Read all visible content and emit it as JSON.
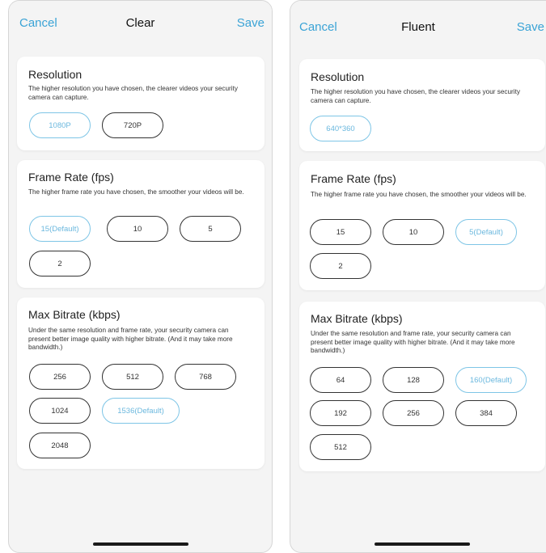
{
  "left": {
    "nav": {
      "cancel": "Cancel",
      "title": "Clear",
      "save": "Save"
    },
    "resolution": {
      "title": "Resolution",
      "desc": "The higher resolution you have chosen, the clearer videos your security camera can capture.",
      "options": [
        "1080P",
        "720P"
      ],
      "selected": "1080P"
    },
    "frame_rate": {
      "title": "Frame Rate (fps)",
      "desc": "The higher frame rate you have chosen, the smoother your videos will be.",
      "options": [
        "15(Default)",
        "10",
        "5",
        "2"
      ],
      "selected": "15(Default)"
    },
    "bitrate": {
      "title": "Max Bitrate (kbps)",
      "desc": "Under the same resolution and frame rate, your security camera can present better image quality with higher bitrate. (And it may take more bandwidth.)",
      "options": [
        "256",
        "512",
        "768",
        "1024",
        "1536(Default)",
        "2048"
      ],
      "selected": "1536(Default)"
    }
  },
  "right": {
    "nav": {
      "cancel": "Cancel",
      "title": "Fluent",
      "save": "Save"
    },
    "resolution": {
      "title": "Resolution",
      "desc": "The higher resolution you have chosen, the clearer videos your security camera can capture.",
      "options": [
        "640*360"
      ],
      "selected": "640*360"
    },
    "frame_rate": {
      "title": "Frame Rate (fps)",
      "desc": "The higher frame rate you have chosen, the smoother your videos will be.",
      "options": [
        "15",
        "10",
        "5(Default)",
        "2"
      ],
      "selected": "5(Default)"
    },
    "bitrate": {
      "title": "Max Bitrate (kbps)",
      "desc": "Under the same resolution and frame rate, your security camera can present better image quality with higher bitrate. (And it may take more bandwidth.)",
      "options": [
        "64",
        "128",
        "160(Default)",
        "192",
        "256",
        "384",
        "512"
      ],
      "selected": "160(Default)"
    }
  },
  "colors": {
    "accent": "#3aa3d6",
    "selected_border": "#7ec5e6",
    "background": "#f4f4f4"
  }
}
